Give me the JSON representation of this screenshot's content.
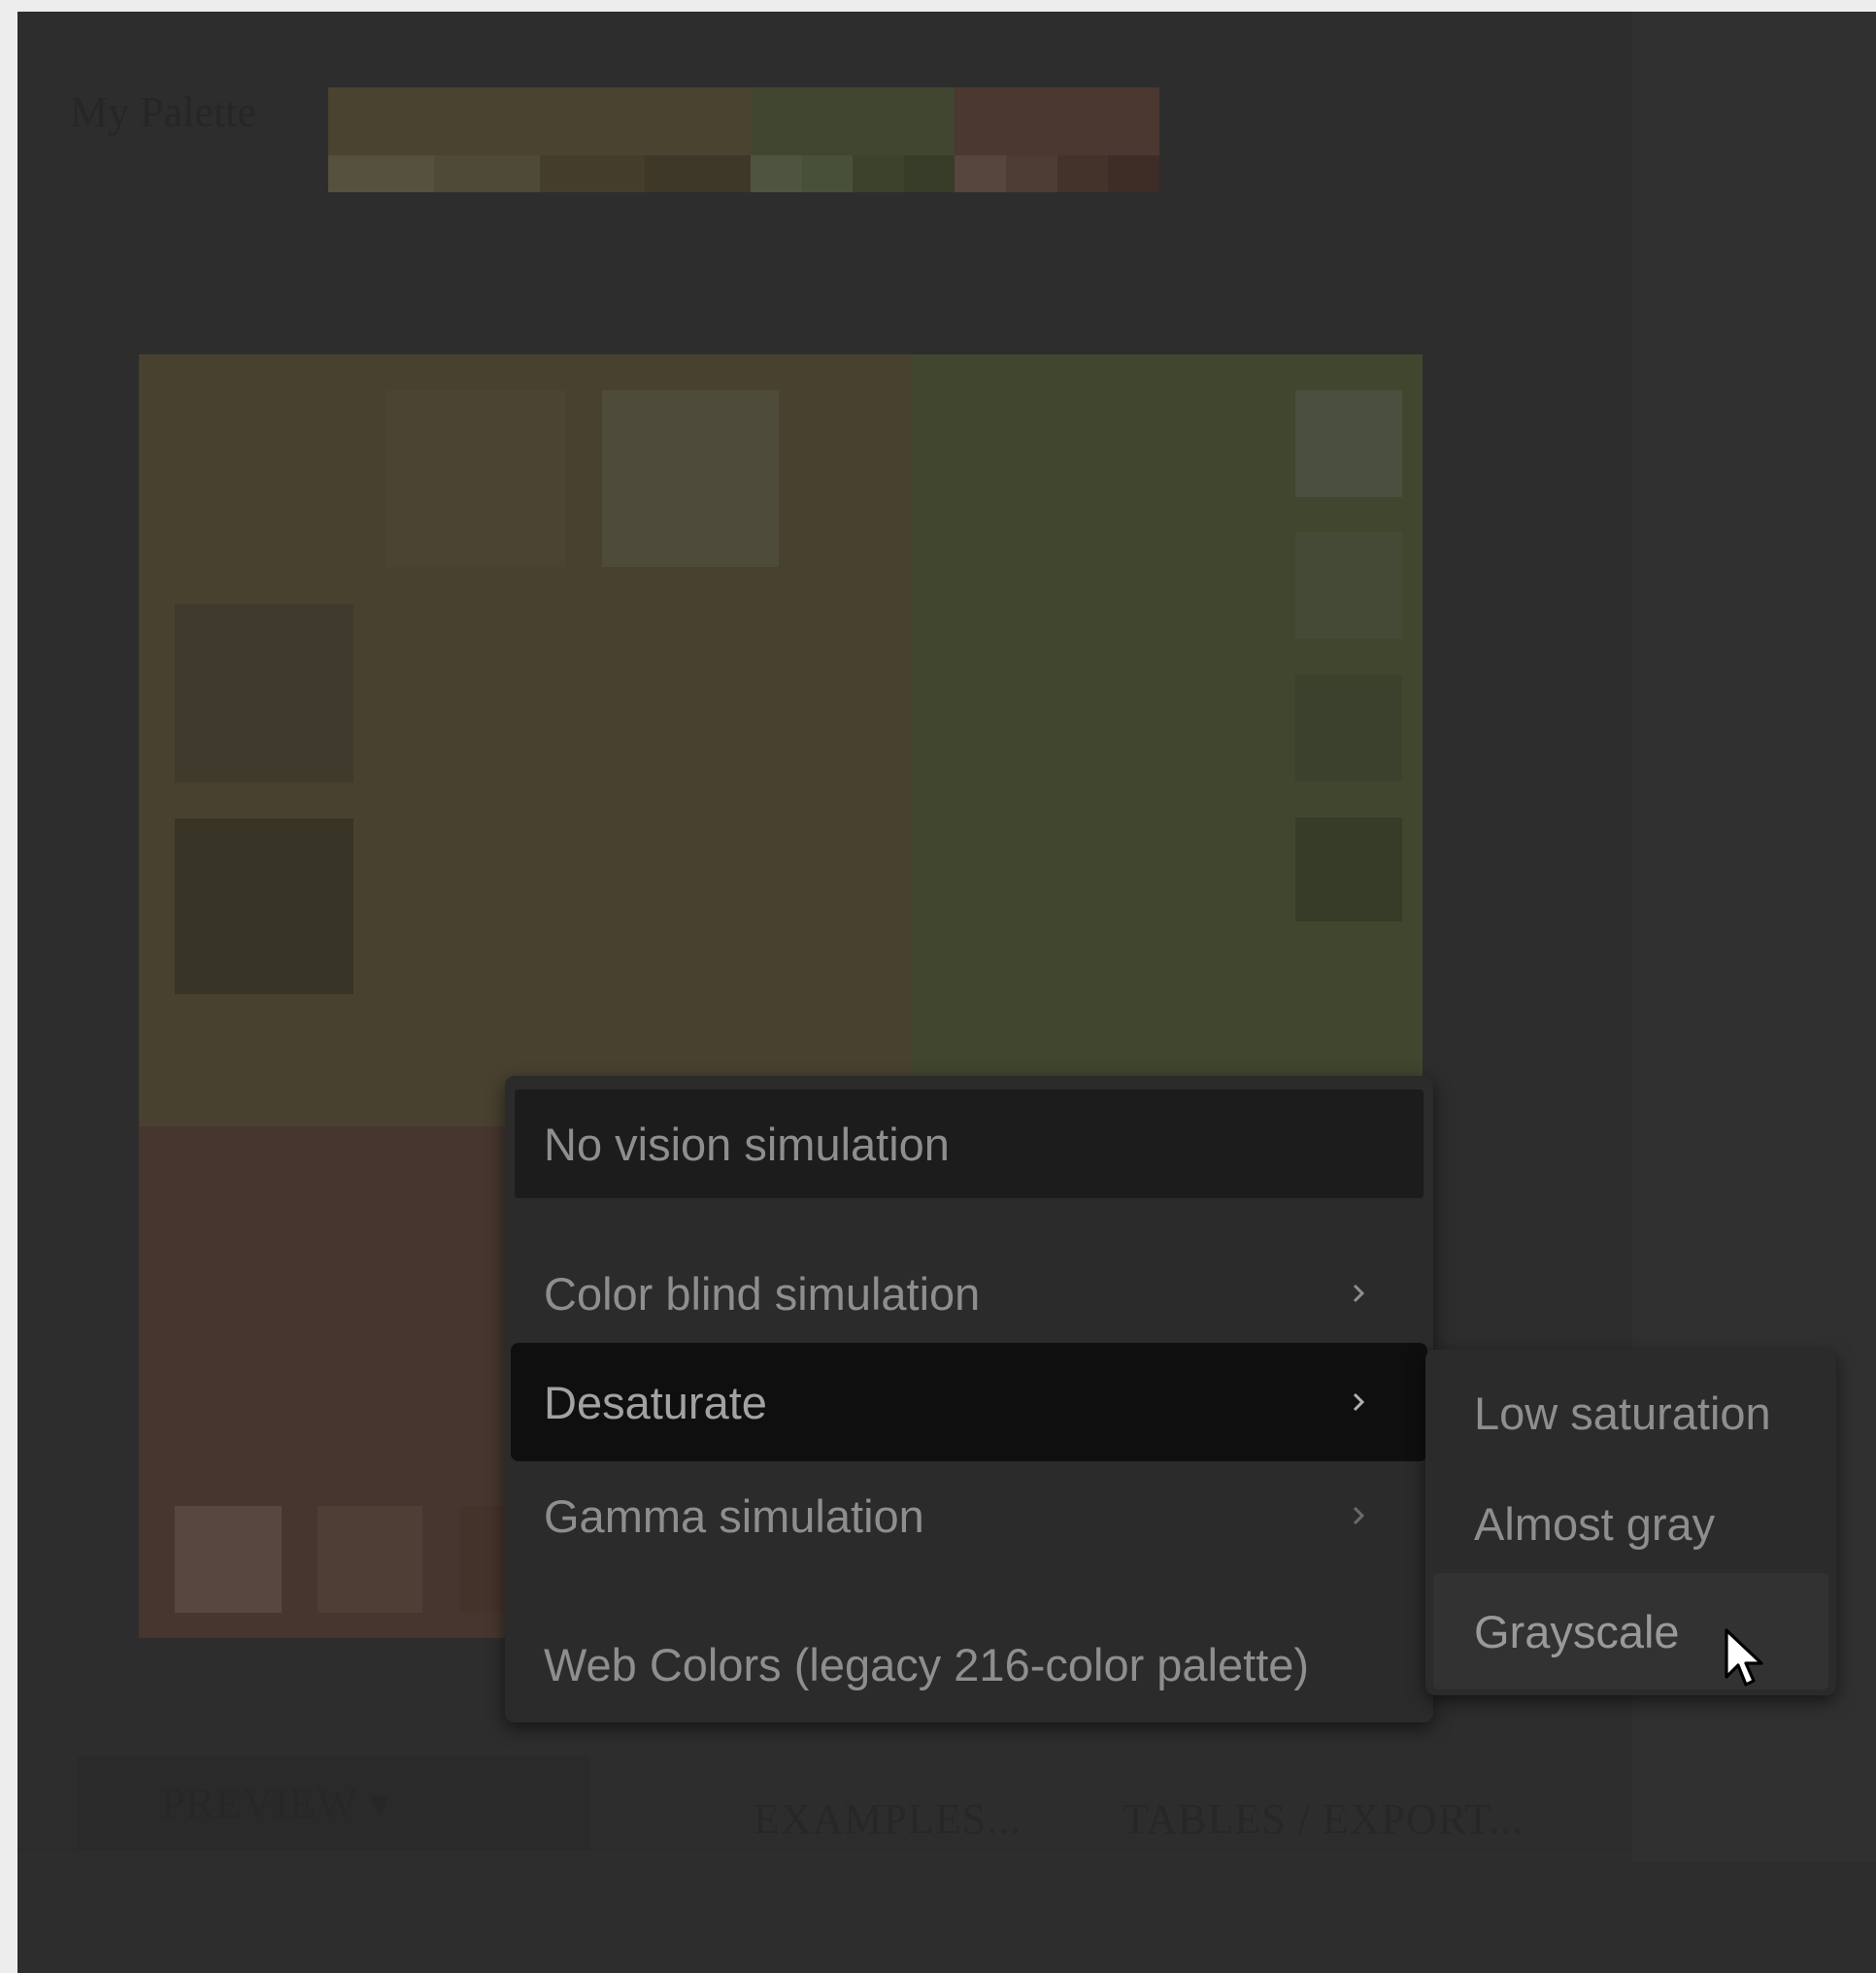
{
  "palette": {
    "title": "My Palette",
    "groups": [
      {
        "main": "#4a432f",
        "shades": [
          "#56503f",
          "#4f4937",
          "#443d2c",
          "#3d3828"
        ]
      },
      {
        "main": "#414630",
        "shades": [
          "#4f5441",
          "#48503a",
          "#3c422b",
          "#383d29"
        ]
      },
      {
        "main": "#4b3830",
        "shades": [
          "#57463e",
          "#4e3d35",
          "#44332b",
          "#3d2d26"
        ]
      }
    ]
  },
  "preview_colors": {
    "yellowish": "#484130",
    "greenish": "#41462f",
    "brownish": "#46362f"
  },
  "tabs": {
    "preview": "PREVIEW ▾",
    "examples": "EXAMPLES...",
    "tables_export": "TABLES / EXPORT..."
  },
  "menu": {
    "items": [
      {
        "label": "No vision simulation",
        "has_submenu": false
      },
      {
        "label": "Color blind simulation",
        "has_submenu": true
      },
      {
        "label": "Desaturate",
        "has_submenu": true,
        "active": true
      },
      {
        "label": "Gamma simulation",
        "has_submenu": true
      },
      {
        "label": "Web Colors (legacy 216-color palette)",
        "has_submenu": false
      }
    ]
  },
  "submenu": {
    "items": [
      {
        "label": "Low saturation"
      },
      {
        "label": "Almost gray"
      },
      {
        "label": "Grayscale",
        "hovered": true
      }
    ]
  },
  "icons": {
    "chevron": "chevron-right-icon",
    "cursor": "mouse-pointer-icon"
  }
}
